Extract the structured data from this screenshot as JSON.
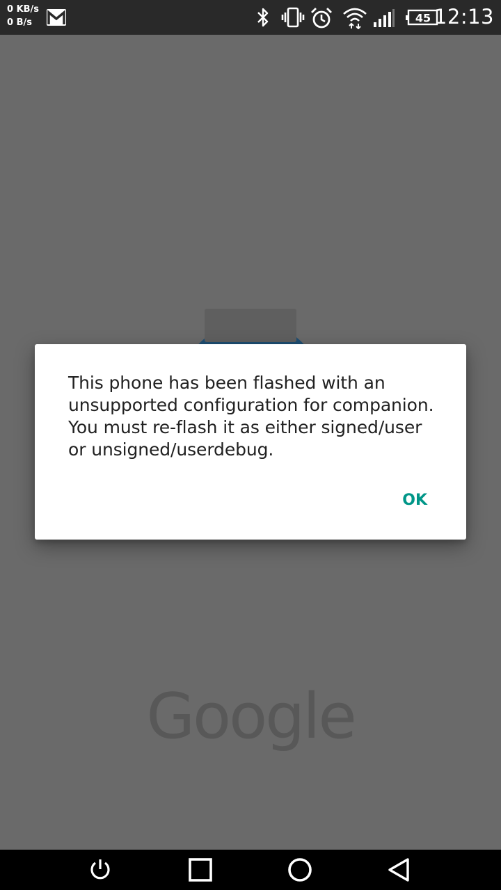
{
  "status_bar": {
    "download_speed": "0 KB/s",
    "upload_speed": "0 B/s",
    "battery_level": "45",
    "time": "12:13",
    "icons": [
      "gmail-icon",
      "bluetooth-icon",
      "vibrate-icon",
      "alarm-icon",
      "wifi-icon",
      "cell-signal-icon",
      "battery-icon"
    ]
  },
  "background": {
    "logo_text": "Google",
    "watch_color": "#1f4f73"
  },
  "dialog": {
    "message": "This phone has been flashed with an unsupported configuration for companion. You must re-flash it as either signed/user or unsigned/userdebug.",
    "ok_label": "OK",
    "accent_color": "#009688"
  },
  "nav_bar": {
    "icons": [
      "power-icon",
      "recents-icon",
      "home-icon",
      "back-icon"
    ]
  }
}
